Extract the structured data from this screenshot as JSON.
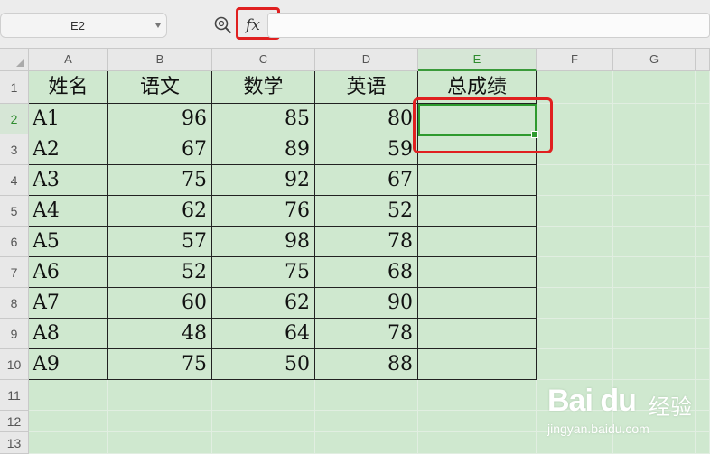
{
  "formula_bar": {
    "cell_reference": "E2",
    "fx_label": "fx",
    "formula_value": ""
  },
  "columns": [
    "A",
    "B",
    "C",
    "D",
    "E",
    "F",
    "G"
  ],
  "rows": [
    "1",
    "2",
    "3",
    "4",
    "5",
    "6",
    "7",
    "8",
    "9",
    "10",
    "11",
    "12",
    "13"
  ],
  "active_cell": {
    "column": "E",
    "row": "2"
  },
  "sheet": {
    "headers": [
      "姓名",
      "语文",
      "数学",
      "英语",
      "总成绩"
    ],
    "records": [
      [
        "A1",
        "96",
        "85",
        "80",
        ""
      ],
      [
        "A2",
        "67",
        "89",
        "59",
        ""
      ],
      [
        "A3",
        "75",
        "92",
        "67",
        ""
      ],
      [
        "A4",
        "62",
        "76",
        "52",
        ""
      ],
      [
        "A5",
        "57",
        "98",
        "78",
        ""
      ],
      [
        "A6",
        "52",
        "75",
        "68",
        ""
      ],
      [
        "A7",
        "60",
        "62",
        "90",
        ""
      ],
      [
        "A8",
        "48",
        "64",
        "78",
        ""
      ],
      [
        "A9",
        "75",
        "50",
        "88",
        ""
      ]
    ]
  },
  "watermark": {
    "logo": "Bai du",
    "chinese": "经验",
    "url": "jingyan.baidu.com"
  },
  "colors": {
    "sheet_background": "#cfe8cf",
    "selection_green": "#2e9a2e",
    "highlight_red": "#e02020"
  },
  "icons": [
    "zoom-formula-icon",
    "dropdown-caret-icon"
  ]
}
